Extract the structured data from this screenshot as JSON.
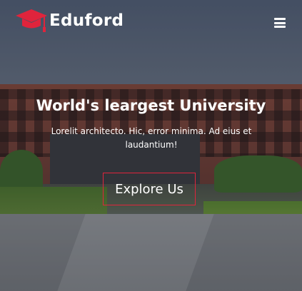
{
  "navbar": {
    "brand": "Eduford",
    "logo_icon": "graduation-cap-icon",
    "menu_icon": "hamburger-menu-icon"
  },
  "hero": {
    "title": "World's leargest University",
    "subtitle": "Lorelit architecto. Hic, error minima. Ad eius et laudantium!",
    "cta_label": "Explore Us"
  },
  "colors": {
    "accent": "#e0243c",
    "text": "#ffffff"
  }
}
